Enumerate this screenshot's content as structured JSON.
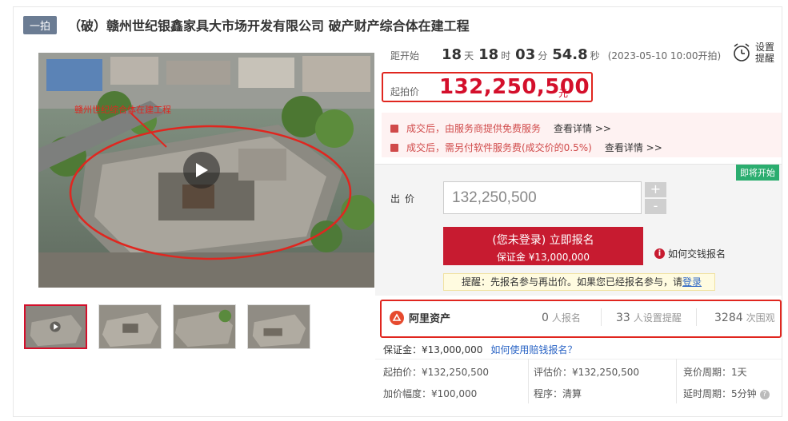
{
  "header": {
    "tag": "一拍",
    "title": "（破）赣州世纪银鑫家具大市场开发有限公司 破产财产综合体在建工程"
  },
  "main_image": {
    "overlay_text": "赣州世纪综合体在建工程"
  },
  "countdown": {
    "label": "距开始",
    "days": "18",
    "days_unit": "天",
    "hours": "18",
    "hours_unit": "时",
    "minutes": "03",
    "minutes_unit": "分",
    "seconds": "54.8",
    "seconds_unit": "秒",
    "start_time": "(2023-05-10 10:00开拍)"
  },
  "reminder": {
    "label_line1": "设置",
    "label_line2": "提醒"
  },
  "start_price": {
    "label": "起拍价",
    "value": "132,250,500",
    "unit": "元"
  },
  "notices": [
    {
      "text": "成交后，由服务商提供免费服务",
      "link": "查看详情 >>"
    },
    {
      "text": "成交后，需另付软件服务费(成交价的0.5%)",
      "link": "查看详情 >>"
    }
  ],
  "bid": {
    "badge": "即将开始",
    "label": "出价",
    "input_value": "132,250,500",
    "plus": "+",
    "minus": "-",
    "register_line1": "(您未登录) 立即报名",
    "register_line2": "保证金 ¥13,000,000",
    "howto": "如何交钱报名",
    "tip_prefix": "提醒：先报名参与再出价。如果您已经报名参与，请",
    "tip_link": "登录"
  },
  "stats": {
    "logo_text": "阿里资产",
    "signups": "0",
    "signups_label": "人报名",
    "reminders": "33",
    "reminders_label": "人设置提醒",
    "views": "3284",
    "views_label": "次围观"
  },
  "deposit": {
    "text": "保证金：¥13,000,000",
    "link": "如何使用赔钱报名？"
  },
  "details": {
    "start_price": "起拍价：¥132,250,500",
    "increment": "加价幅度：¥100,000",
    "appraisal": "评估价：¥132,250,500",
    "procedure": "程序：清算",
    "bid_period": "竞价周期：1天",
    "extension": "延时周期：5分钟"
  },
  "colors": {
    "brand_red": "#c71b30",
    "highlight_red": "#e0261f",
    "price_red": "#d40f2b",
    "badge_green": "#2bad6f",
    "link_blue": "#2a64c5"
  }
}
